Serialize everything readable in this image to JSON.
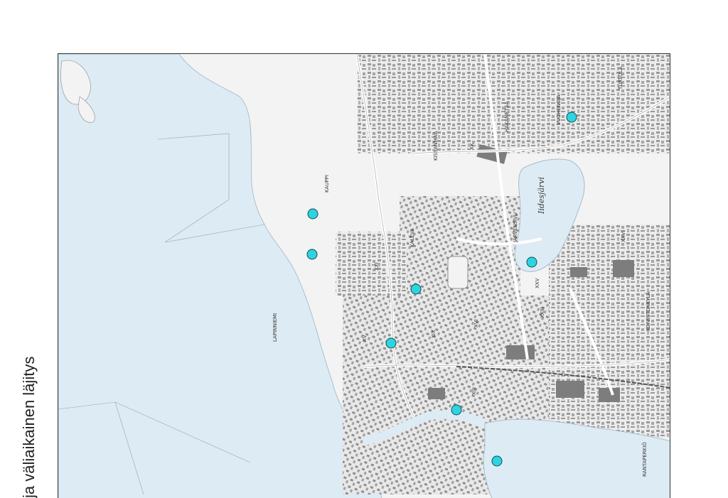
{
  "title": "ja väliaikainen läjitys",
  "colors": {
    "water": "#dcebf4",
    "land": "#f3f3f3",
    "building": "#8a8a8a",
    "road": "#ffffff",
    "marker": "#2fd3e0",
    "marker_stroke": "#0b4f57"
  },
  "map": {
    "labels": {
      "kaupi": "KAUPPI",
      "kissanmaa": "KISSANMAA",
      "kaleva": "KALEVA",
      "hakametsa": "HAKAMETSÄ",
      "vuohenoja": "VUOHENOJA",
      "turtola": "TURTOLA",
      "jarvensivu": "JÄRVENSIVU",
      "iidesjarvi": "Iidesjärvi",
      "lapinniemi": "LAPINNIEMI",
      "kolmenkulma": "KOIVISTONKYLÄ",
      "rantaperkio": "RANTAPERKIÖ",
      "xxi": "XXI",
      "xxv": "XXV",
      "xiii": "XIII",
      "xv": "XV",
      "xvi": "XVI",
      "xxiii": "XXIII",
      "xxvi": "XXVI",
      "xx": "XX",
      "xix": "XIX"
    },
    "markers": [
      {
        "id": "m1"
      },
      {
        "id": "m2"
      },
      {
        "id": "m3"
      },
      {
        "id": "m4"
      },
      {
        "id": "m5"
      },
      {
        "id": "m6"
      },
      {
        "id": "m7"
      },
      {
        "id": "m8"
      }
    ]
  }
}
